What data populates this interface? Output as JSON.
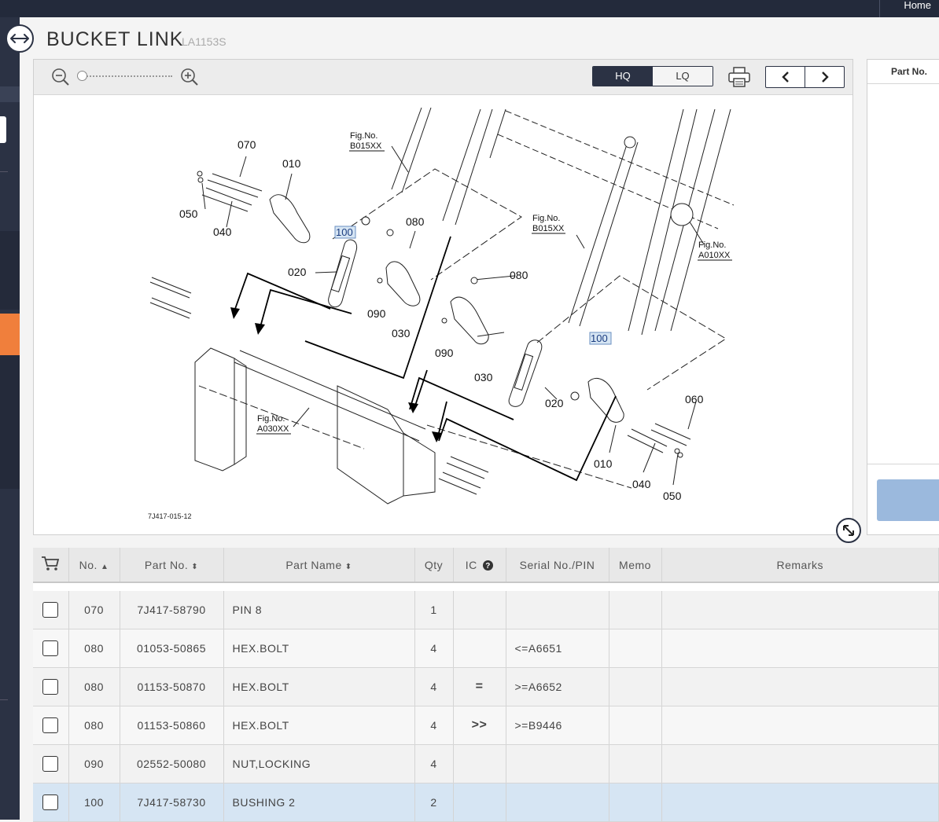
{
  "header": {
    "home_label": "Home"
  },
  "page": {
    "title": "BUCKET LINK",
    "model_code": "LA1153S"
  },
  "viewer": {
    "quality_options": [
      "HQ",
      "LQ"
    ],
    "selected_quality": "HQ",
    "zoom_level": 0
  },
  "diagram": {
    "figure_code": "7J417-015-12",
    "callouts": [
      "070",
      "010",
      "050",
      "040",
      "100",
      "080",
      "020",
      "090",
      "030",
      "080",
      "100",
      "090",
      "030",
      "020",
      "060",
      "010",
      "040",
      "050"
    ],
    "fig_refs": [
      {
        "label": "Fig.No.",
        "code": "B015XX"
      },
      {
        "label": "Fig.No.",
        "code": "B015XX"
      },
      {
        "label": "Fig.No.",
        "code": "A010XX"
      },
      {
        "label": "Fig.No.",
        "code": "A030XX"
      }
    ]
  },
  "side_panel": {
    "header": "Part No."
  },
  "table": {
    "columns": {
      "no": "No.",
      "part_no": "Part No.",
      "part_name": "Part Name",
      "qty": "Qty",
      "ic": "IC",
      "serial": "Serial No./PIN",
      "memo": "Memo",
      "remarks": "Remarks"
    },
    "rows": [
      {
        "no": "070",
        "part_no": "7J417-58790",
        "part_name": "PIN 8",
        "qty": "1",
        "ic": "",
        "serial": "",
        "memo": "",
        "remarks": "",
        "selected": false
      },
      {
        "no": "080",
        "part_no": "01053-50865",
        "part_name": "HEX.BOLT",
        "qty": "4",
        "ic": "",
        "serial": "<=A6651",
        "memo": "",
        "remarks": "",
        "selected": false
      },
      {
        "no": "080",
        "part_no": "01153-50870",
        "part_name": "HEX.BOLT",
        "qty": "4",
        "ic": "=",
        "serial": ">=A6652",
        "memo": "",
        "remarks": "",
        "selected": false
      },
      {
        "no": "080",
        "part_no": "01153-50860",
        "part_name": "HEX.BOLT",
        "qty": "4",
        "ic": ">>",
        "serial": ">=B9446",
        "memo": "",
        "remarks": "",
        "selected": false
      },
      {
        "no": "090",
        "part_no": "02552-50080",
        "part_name": "NUT,LOCKING",
        "qty": "4",
        "ic": "",
        "serial": "",
        "memo": "",
        "remarks": "",
        "selected": false
      },
      {
        "no": "100",
        "part_no": "7J417-58730",
        "part_name": "BUSHING 2",
        "qty": "2",
        "ic": "",
        "serial": "",
        "memo": "",
        "remarks": "",
        "selected": true
      }
    ]
  },
  "colors": {
    "dark_nav": "#2b3244",
    "accent_orange": "#f07f3c",
    "selected_row": "#d6e5f3",
    "button_blue": "#9bb9dd"
  }
}
